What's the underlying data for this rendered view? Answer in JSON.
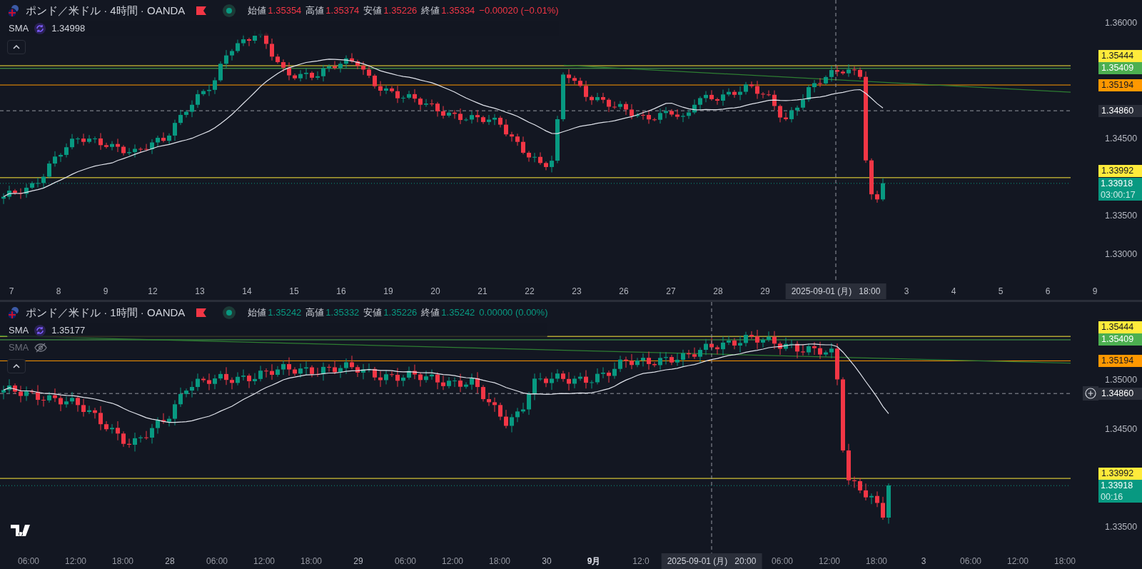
{
  "panes": [
    {
      "symbol": "ポンド／米ドル · 4時間 · OANDA",
      "falling": true,
      "ohlc": [
        {
          "label": "始値",
          "value": "1.35354"
        },
        {
          "label": "高値",
          "value": "1.35374"
        },
        {
          "label": "安値",
          "value": "1.35226"
        },
        {
          "label": "終値",
          "value": "1.35334"
        }
      ],
      "change": "−0.00020 (−0.01%)",
      "indicators": [
        {
          "name": "SMA",
          "value": "1.34998",
          "visible": true
        }
      ],
      "price_ticks": [
        "1.36000",
        "1.34500",
        "1.33500",
        "1.33000"
      ],
      "price_labels": [
        {
          "value": "1.35444",
          "color": "#ffeb3b",
          "kind": "alert"
        },
        {
          "value": "1.35409",
          "color": "#4caf50",
          "kind": "alert"
        },
        {
          "value": "1.35194",
          "color": "#ff9800",
          "kind": "alert"
        },
        {
          "value": "1.34860",
          "color": "#2a2e39",
          "kind": "crosshair",
          "plus_button": false
        },
        {
          "value": "1.33992",
          "color": "#ffeb3b",
          "kind": "alert"
        }
      ],
      "last_price": {
        "value": "1.33918",
        "countdown": "03:00:17"
      },
      "time_labels": [
        {
          "text": "7",
          "kind": "date"
        },
        {
          "text": "8",
          "kind": "date"
        },
        {
          "text": "9",
          "kind": "date"
        },
        {
          "text": "12",
          "kind": "date"
        },
        {
          "text": "13",
          "kind": "date"
        },
        {
          "text": "14",
          "kind": "date"
        },
        {
          "text": "15",
          "kind": "date"
        },
        {
          "text": "16",
          "kind": "date"
        },
        {
          "text": "19",
          "kind": "date"
        },
        {
          "text": "20",
          "kind": "date"
        },
        {
          "text": "21",
          "kind": "date"
        },
        {
          "text": "22",
          "kind": "date"
        },
        {
          "text": "23",
          "kind": "date"
        },
        {
          "text": "26",
          "kind": "date"
        },
        {
          "text": "27",
          "kind": "date"
        },
        {
          "text": "28",
          "kind": "date"
        },
        {
          "text": "29",
          "kind": "date"
        },
        {
          "text": "2025-09-01 (月)   18:00",
          "kind": "crosshair"
        },
        {
          "text": "3",
          "kind": "date"
        },
        {
          "text": "4",
          "kind": "date"
        },
        {
          "text": "5",
          "kind": "date"
        },
        {
          "text": "6",
          "kind": "date"
        },
        {
          "text": "9",
          "kind": "date"
        }
      ],
      "logo": false
    },
    {
      "symbol": "ポンド／米ドル · 1時間 · OANDA",
      "falling": false,
      "ohlc": [
        {
          "label": "始値",
          "value": "1.35242"
        },
        {
          "label": "高値",
          "value": "1.35332"
        },
        {
          "label": "安値",
          "value": "1.35226"
        },
        {
          "label": "終値",
          "value": "1.35242"
        }
      ],
      "change": "0.00000 (0.00%)",
      "indicators": [
        {
          "name": "SMA",
          "value": "1.35177",
          "visible": true
        },
        {
          "name": "SMA",
          "visible": false
        }
      ],
      "price_ticks": [
        "1.35000",
        "1.34500",
        "1.33500"
      ],
      "price_labels": [
        {
          "value": "1.35444",
          "color": "#ffeb3b",
          "kind": "alert"
        },
        {
          "value": "1.35409",
          "color": "#4caf50",
          "kind": "alert"
        },
        {
          "value": "1.35194",
          "color": "#ff9800",
          "kind": "alert"
        },
        {
          "value": "1.34860",
          "color": "#2a2e39",
          "kind": "crosshair",
          "plus_button": true
        },
        {
          "value": "1.33992",
          "color": "#ffeb3b",
          "kind": "alert"
        }
      ],
      "last_price": {
        "value": "1.33918",
        "countdown": "00:16"
      },
      "time_labels": [
        {
          "text": "06:00",
          "kind": "time"
        },
        {
          "text": "12:00",
          "kind": "time"
        },
        {
          "text": "18:00",
          "kind": "time"
        },
        {
          "text": "28",
          "kind": "date"
        },
        {
          "text": "06:00",
          "kind": "time"
        },
        {
          "text": "12:00",
          "kind": "time"
        },
        {
          "text": "18:00",
          "kind": "time"
        },
        {
          "text": "29",
          "kind": "date"
        },
        {
          "text": "06:00",
          "kind": "time"
        },
        {
          "text": "12:00",
          "kind": "time"
        },
        {
          "text": "18:00",
          "kind": "time"
        },
        {
          "text": "30",
          "kind": "date"
        },
        {
          "text": "9月",
          "kind": "month"
        },
        {
          "text": "12:0",
          "kind": "time"
        },
        {
          "text": "2025-09-01 (月)   20:00",
          "kind": "crosshair"
        },
        {
          "text": "06:00",
          "kind": "time"
        },
        {
          "text": "12:00",
          "kind": "time"
        },
        {
          "text": "18:00",
          "kind": "time"
        },
        {
          "text": "3",
          "kind": "date"
        },
        {
          "text": "06:00",
          "kind": "time"
        },
        {
          "text": "12:00",
          "kind": "time"
        },
        {
          "text": "18:00",
          "kind": "time"
        }
      ],
      "logo": true
    }
  ]
}
